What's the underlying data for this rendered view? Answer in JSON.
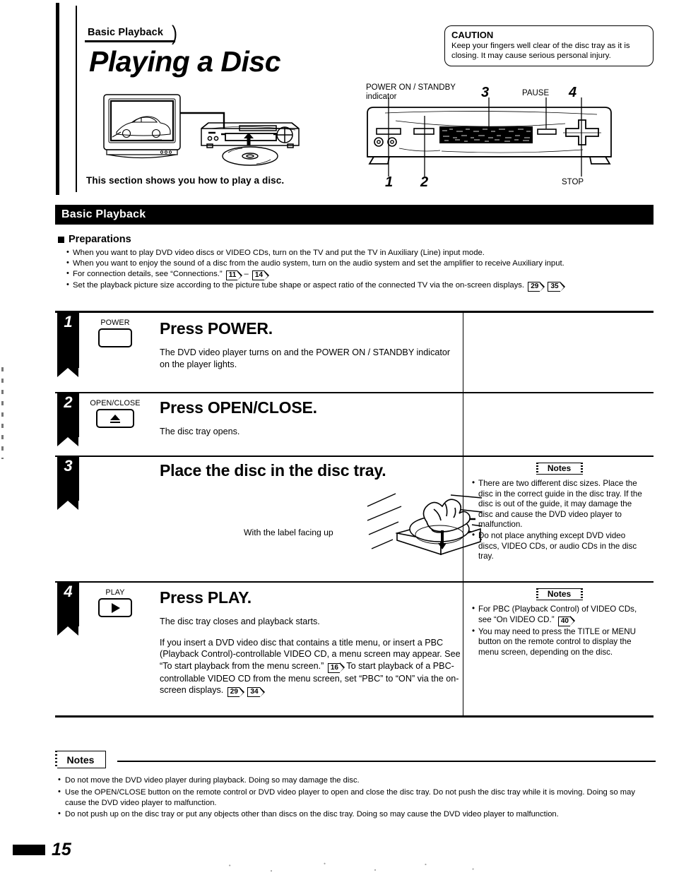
{
  "header": {
    "tab_label": "Basic Playback",
    "title": "Playing a Disc",
    "intro": "This section shows you how to play a disc."
  },
  "caution": {
    "title": "CAUTION",
    "body": "Keep your fingers well clear of the disc tray as it is closing. It may cause serious personal injury."
  },
  "front_panel": {
    "power_indicator_label_line1": "POWER ON / STANDBY",
    "power_indicator_label_line2": "indicator",
    "pause_label": "PAUSE",
    "stop_label": "STOP",
    "callout_1": "1",
    "callout_2": "2",
    "callout_3": "3",
    "callout_4": "4"
  },
  "section": {
    "bar_title": "Basic Playback",
    "preparations_heading": "Preparations",
    "preparations": [
      {
        "text": "When you want to play DVD video discs or VIDEO CDs, turn on the TV and put the TV in Auxiliary (Line) input mode.",
        "refs": []
      },
      {
        "text": "When you want to enjoy the sound of a disc from the audio system, turn on the audio system and set the amplifier to receive Auxiliary input.",
        "refs": []
      },
      {
        "text": "For connection details, see “Connections.”",
        "refs": [
          "11",
          "14"
        ],
        "separator": "–"
      },
      {
        "text": "Set the playback picture size according to the picture tube shape or aspect ratio of the connected TV via the on-screen displays.",
        "refs": [
          "29",
          "35"
        ]
      }
    ]
  },
  "steps": [
    {
      "number": "1",
      "button_label": "POWER",
      "button_glyph": "blank",
      "title": "Press POWER.",
      "body": [
        "The DVD video player turns on and the POWER ON / STANDBY indicator on the player lights."
      ],
      "notes": null
    },
    {
      "number": "2",
      "button_label": "OPEN/CLOSE",
      "button_glyph": "eject-icon",
      "title": "Press OPEN/CLOSE.",
      "body": [
        "The disc tray opens."
      ],
      "notes": null
    },
    {
      "number": "3",
      "button_label": "",
      "button_glyph": "",
      "title": "Place the disc in the disc tray.",
      "illustration_caption": "With the label facing up",
      "body": [],
      "notes": {
        "heading": "Notes",
        "items": [
          "There are two different disc sizes. Place the disc in the correct guide in the disc tray. If the disc is out of the guide, it may damage the disc and cause the DVD video player to malfunction.",
          "Do not place anything except DVD video discs, VIDEO CDs, or audio CDs in the disc tray."
        ]
      }
    },
    {
      "number": "4",
      "button_label": "PLAY",
      "button_glyph": "play-icon",
      "title": "Press PLAY.",
      "body": [
        "The disc tray closes and playback starts."
      ],
      "body2_part1": "If you insert a DVD video disc that contains a title menu, or insert a PBC (Playback Control)-controllable VIDEO CD, a menu screen may appear.  See “To start playback from the menu screen.”",
      "body2_ref1": "16",
      "body2_part2": "To start playback of a PBC-controllable VIDEO CD from the menu screen, set “PBC” to “ON” via the on-screen displays.",
      "body2_ref2": "29",
      "body2_ref3": "34",
      "notes": {
        "heading": "Notes",
        "items_rich": [
          {
            "text_before": "For PBC (Playback Control) of VIDEO CDs, see “On VIDEO CD.”",
            "ref": "40"
          },
          {
            "text_before": "You may need to press the TITLE or MENU button on the remote control to display the menu screen, depending on the disc.",
            "ref": null
          }
        ]
      }
    }
  ],
  "bottom_notes": {
    "heading": "Notes",
    "items": [
      "Do not move the DVD video player during playback. Doing so may damage the disc.",
      "Use the OPEN/CLOSE button on the remote control or DVD video player to open and close the disc tray. Do not push the disc tray while it is moving. Doing so may cause the DVD video player to malfunction.",
      "Do not push up on the disc tray or put any objects other than discs on the disc tray. Doing so may cause the DVD video player to malfunction."
    ]
  },
  "footer": {
    "page_number": "15"
  }
}
